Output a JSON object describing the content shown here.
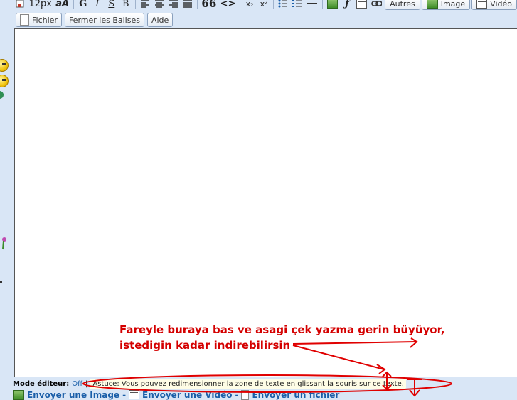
{
  "toolbar": {
    "font_size": "12px",
    "text_size_icon": "aA",
    "bold": "G",
    "italic": "I",
    "underline": "S",
    "strike": "B",
    "quote": "66",
    "code": "<>",
    "subscript": "x₂",
    "superscript": "x²",
    "autres_label": "Autres",
    "image_label": "Image",
    "video_label": "Vidéo"
  },
  "toolbar2": {
    "fichier_label": "Fichier",
    "fermer_label": "Fermer les Balises",
    "aide_label": "Aide"
  },
  "status": {
    "mode_label": "Mode éditeur:",
    "mode_value": "Off",
    "separator": "|",
    "tip": "Astuce: Vous pouvez redimensionner la zone de texte en glissant la souris sur ce texte."
  },
  "annotation": {
    "line1": "Fareyle buraya bas ve asagi çek yazma gerin büyüyor,",
    "line2": "istedigin kadar indirebilirsin",
    "color": "#d40000"
  },
  "bottom": {
    "image_link": "Envoyer une Image",
    "video_link": "Envoyer une Vidéo",
    "file_link": "Envoyer un fichier",
    "dash": "-"
  }
}
